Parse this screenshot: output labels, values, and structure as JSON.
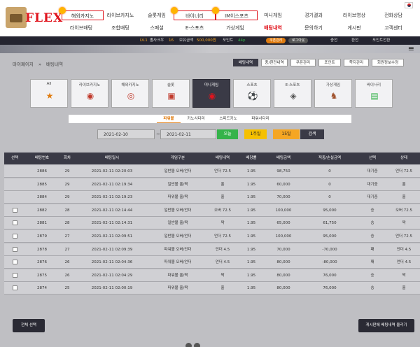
{
  "brand": {
    "name": "FLEX"
  },
  "nav": {
    "row1": [
      "해외카지노",
      "라이브카지노",
      "슬롯게임",
      "",
      "바이너리",
      "IM이스포츠",
      "미니게임",
      "경기결과",
      "라이브영상",
      "전화상담"
    ],
    "row2": [
      "라이브배팅",
      "조합배팅",
      "스페셜",
      "",
      "E-스포츠",
      "가상게임",
      "배팅내역",
      "문의하기",
      "게시판",
      "고객센터"
    ]
  },
  "user": {
    "level": "LV.1",
    "username": "졸사크우",
    "badge": "16",
    "money_label": "보유금액",
    "money": "500,000원",
    "point_label": "포인트",
    "point": "44p",
    "btn_coupon": "쿠폰관리",
    "btn_logout": "로그아웃",
    "btn_charge": "충전",
    "btn_exchange": "환전",
    "btn_point": "포인트전환"
  },
  "breadcrumb": {
    "home": "마이페이지",
    "sep": "»",
    "current": "배팅내역"
  },
  "record_tabs": [
    "배팅내역",
    "충/환전내역",
    "쿠폰관리",
    "포인트",
    "쪽지관리",
    "회원정보수정"
  ],
  "categories": [
    {
      "label": "All",
      "icon": "star-icon",
      "glyph": "★"
    },
    {
      "label": "라이브카지노",
      "icon": "chip-icon",
      "glyph": "◉"
    },
    {
      "label": "해외카지노",
      "icon": "chips-stack-icon",
      "glyph": "◎"
    },
    {
      "label": "슬롯",
      "icon": "slot-machine-icon",
      "glyph": "▣"
    },
    {
      "label": "미니게임",
      "icon": "mini-game-icon",
      "glyph": "◉"
    },
    {
      "label": "스포츠",
      "icon": "soccer-ball-icon",
      "glyph": "⚽"
    },
    {
      "label": "E-스포츠",
      "icon": "gamepad-icon",
      "glyph": "◈"
    },
    {
      "label": "가상게임",
      "icon": "horse-icon",
      "glyph": "♞"
    },
    {
      "label": "바이너리",
      "icon": "chart-icon",
      "glyph": "▤"
    }
  ],
  "sub_tabs": [
    "파워볼",
    "키노사다리",
    "스피드키노",
    "파워사다리"
  ],
  "filter": {
    "date_from": "2021-02-10",
    "tilde": "~",
    "date_to": "2021-02-11",
    "btn_today": "오늘",
    "btn_week": "1주일",
    "btn_15": "15일",
    "btn_search": "검색"
  },
  "table": {
    "headers": [
      "선택",
      "배팅번호",
      "회차",
      "배팅일시",
      "게임구분",
      "배팅내역",
      "배당률",
      "배팅금액",
      "적중/손실금액",
      "선택",
      "상태"
    ],
    "rows": [
      {
        "check": false,
        "id": "2886",
        "round": "29",
        "time": "2021-02-11 02:20:03",
        "game": "일반볼 오버/언더",
        "bet": "언더 72.5",
        "odds": "1.95",
        "amount": "98,750",
        "result": "0",
        "pick": "대기중",
        "status": "언더 72.5"
      },
      {
        "check": false,
        "id": "2885",
        "round": "29",
        "time": "2021-02-11 02:19:34",
        "game": "일반볼 홀/짝",
        "bet": "홀",
        "odds": "1.95",
        "amount": "60,000",
        "result": "0",
        "pick": "대기중",
        "status": "홀"
      },
      {
        "check": false,
        "id": "2884",
        "round": "29",
        "time": "2021-02-11 02:19:23",
        "game": "파워볼 홀/짝",
        "bet": "홀",
        "odds": "1.95",
        "amount": "70,000",
        "result": "0",
        "pick": "대기중",
        "status": "홀"
      },
      {
        "check": true,
        "id": "2882",
        "round": "28",
        "time": "2021-02-11 02:14:44",
        "game": "일반볼 오버/언더",
        "bet": "오버 72.5",
        "odds": "1.95",
        "amount": "100,000",
        "result": "95,000",
        "pick": "승",
        "status": "오버 72.5"
      },
      {
        "check": true,
        "id": "2881",
        "round": "28",
        "time": "2021-02-11 02:14:31",
        "game": "일반볼 홀/짝",
        "bet": "짝",
        "odds": "1.95",
        "amount": "65,000",
        "result": "61,750",
        "pick": "승",
        "status": "짝"
      },
      {
        "check": true,
        "id": "2879",
        "round": "27",
        "time": "2021-02-11 02:09:51",
        "game": "일반볼 오버/언더",
        "bet": "언더 72.5",
        "odds": "1.95",
        "amount": "100,000",
        "result": "95,000",
        "pick": "승",
        "status": "언더 72.5"
      },
      {
        "check": true,
        "id": "2878",
        "round": "27",
        "time": "2021-02-11 02:09:39",
        "game": "파워볼 오버/언더",
        "bet": "언더 4.5",
        "odds": "1.95",
        "amount": "70,000",
        "result": "-70,000",
        "pick": "패",
        "status": "언더 4.5"
      },
      {
        "check": true,
        "id": "2876",
        "round": "26",
        "time": "2021-02-11 02:04:36",
        "game": "파워볼 오버/언더",
        "bet": "언더 4.5",
        "odds": "1.95",
        "amount": "80,000",
        "result": "-80,000",
        "pick": "패",
        "status": "언더 4.5"
      },
      {
        "check": true,
        "id": "2875",
        "round": "26",
        "time": "2021-02-11 02:04:29",
        "game": "파워볼 홀/짝",
        "bet": "짝",
        "odds": "1.95",
        "amount": "80,000",
        "result": "76,000",
        "pick": "승",
        "status": "짝"
      },
      {
        "check": true,
        "id": "2874",
        "round": "25",
        "time": "2021-02-11 02:00:19",
        "game": "파워볼 홀/짝",
        "bet": "홀",
        "odds": "1.95",
        "amount": "80,000",
        "result": "76,000",
        "pick": "승",
        "status": "홀"
      }
    ]
  },
  "actions": {
    "select_all": "전체 선택",
    "post_board": "게시판에 배팅내역 올리기"
  },
  "colors": {
    "brand_red": "#e0141d",
    "dark": "#3a3a46",
    "orange": "#f5a623",
    "green": "#35b34a"
  }
}
